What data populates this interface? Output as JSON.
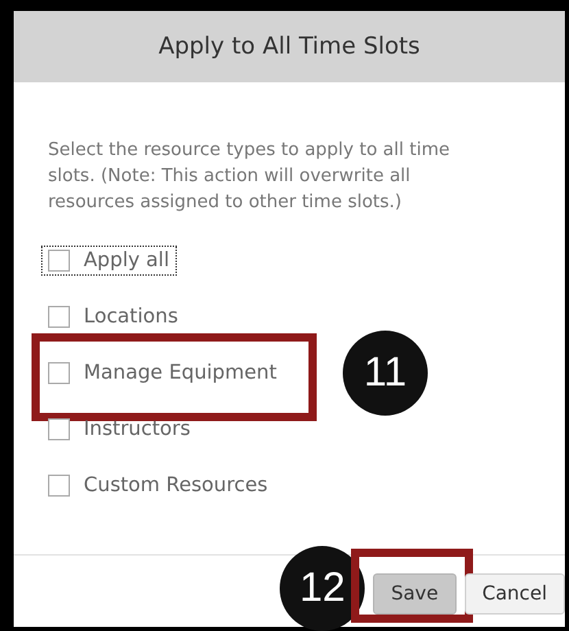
{
  "dialog": {
    "title": "Apply to All Time Slots",
    "description": "Select the resource types to apply to all time slots. (Note: This action will overwrite all resources assigned to other time slots.)",
    "options": [
      {
        "label": "Apply all",
        "checked": false,
        "focused": true,
        "highlighted": false
      },
      {
        "label": "Locations",
        "checked": false,
        "focused": false,
        "highlighted": false
      },
      {
        "label": "Manage Equipment",
        "checked": false,
        "focused": false,
        "highlighted": true,
        "callout": "11"
      },
      {
        "label": "Instructors",
        "checked": false,
        "focused": false,
        "highlighted": false
      },
      {
        "label": "Custom Resources",
        "checked": false,
        "focused": false,
        "highlighted": false
      }
    ],
    "buttons": [
      {
        "label": "Save",
        "kind": "primary",
        "highlighted": true,
        "callout": "12"
      },
      {
        "label": "Cancel",
        "kind": "secondary",
        "highlighted": false
      }
    ]
  }
}
